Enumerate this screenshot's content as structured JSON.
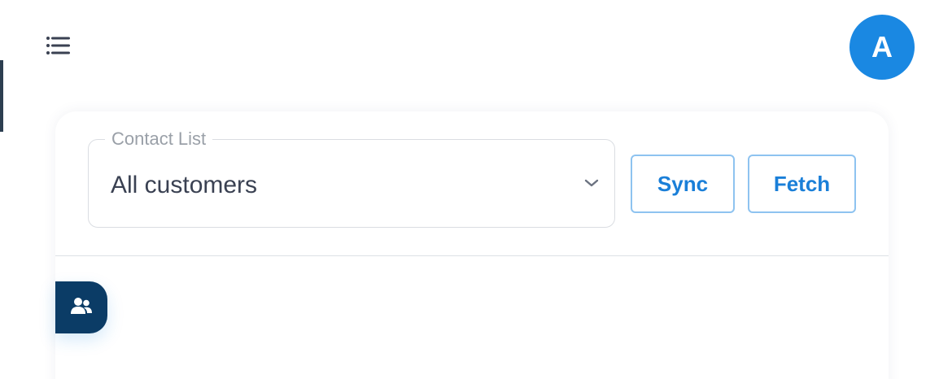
{
  "header": {
    "menu_icon": "hamburger-menu-icon",
    "avatar": {
      "initial": "A",
      "color": "#1a88e2"
    }
  },
  "contact_list": {
    "label": "Contact List",
    "selected_value": "All customers",
    "dropdown_icon": "chevron-down-icon"
  },
  "actions": {
    "sync_label": "Sync",
    "fetch_label": "Fetch",
    "button_color": "#1a7fd8"
  },
  "floating_action": {
    "icon": "contacts-icon",
    "color": "#0b3c66"
  }
}
